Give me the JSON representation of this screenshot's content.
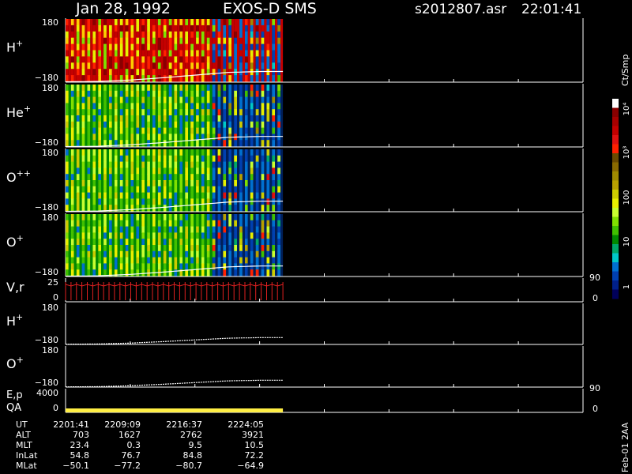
{
  "header": {
    "date": "Jan 28, 1992",
    "instrument": "EXOS-D SMS",
    "file": "s2012807.asr",
    "time": "22:01:41"
  },
  "colors": {
    "trace": "#ffffff",
    "velocity": "#e02020",
    "qa_bar": "#ffee44",
    "frame": "#ffffff"
  },
  "colorbar": {
    "unit": "Ct/Smp",
    "tick_labels": [
      "10⁴",
      "10³",
      "100",
      "10",
      "1"
    ],
    "colors": [
      "#ffffff",
      "#8a0000",
      "#a80000",
      "#c40000",
      "#e01010",
      "#ff2000",
      "#6a4a00",
      "#8a6a00",
      "#a08a00",
      "#b8a000",
      "#cccc00",
      "#e8f000",
      "#c8ff30",
      "#80e000",
      "#40c000",
      "#008a00",
      "#00a868",
      "#00c8c8",
      "#0070d0",
      "#0040b0",
      "#00208a",
      "#00005a"
    ]
  },
  "footer_note": "Feb-01 2AA",
  "chart_data": {
    "type": "heatmap",
    "panels": [
      {
        "name": "H+",
        "label_base": "H",
        "label_sup": "+",
        "ymax_label": "180",
        "ymin_label": "−180",
        "kind": "spectrogram",
        "style": "h"
      },
      {
        "name": "He+",
        "label_base": "He",
        "label_sup": "+",
        "ymax_label": "180",
        "ymin_label": "−180",
        "kind": "spectrogram",
        "style": "he"
      },
      {
        "name": "O++",
        "label_base": "O",
        "label_sup": "++",
        "ymax_label": "180",
        "ymin_label": "−180",
        "kind": "spectrogram",
        "style": "opp"
      },
      {
        "name": "O+",
        "label_base": "O",
        "label_sup": "+",
        "ymax_label": "180",
        "ymin_label": "−180",
        "kind": "spectrogram",
        "style": "op"
      },
      {
        "name": "V,r",
        "label_base": "V,r",
        "label_sup": "",
        "ymax_label": "25",
        "ymin_label": "0",
        "right_top": "90",
        "right_bottom": "0",
        "kind": "velocity"
      },
      {
        "name": "H+",
        "label_base": "H",
        "label_sup": "+",
        "ymax_label": "180",
        "ymin_label": "−180",
        "kind": "line"
      },
      {
        "name": "O+",
        "label_base": "O",
        "label_sup": "+",
        "ymax_label": "180",
        "ymin_label": "−180",
        "kind": "line"
      },
      {
        "name": "E,p / QA",
        "label_base": "E,p",
        "label2": "QA",
        "label_sup": "",
        "ymax_label": "4000",
        "ymin_label": "0",
        "right_top": "90",
        "right_bottom": "0",
        "kind": "qa"
      }
    ],
    "data_time_fraction": 0.42,
    "spin_stripe_count": 40,
    "pitch_angle_trace": [
      [
        0.0,
        -178
      ],
      [
        0.15,
        -176
      ],
      [
        0.3,
        -168
      ],
      [
        0.45,
        -155
      ],
      [
        0.6,
        -140
      ],
      [
        0.75,
        -125
      ],
      [
        0.9,
        -120
      ],
      [
        1.0,
        -120
      ]
    ],
    "time_axis": {
      "UT": [
        "2201:41",
        "2209:09",
        "2216:37",
        "2224:05"
      ],
      "ALT": [
        "703",
        "1627",
        "2762",
        "3921"
      ],
      "MLT": [
        "23.4",
        "0.3",
        "9.5",
        "10.5"
      ],
      "InLat": [
        "54.8",
        "76.7",
        "84.8",
        "72.2"
      ],
      "MLat": [
        "−50.1",
        "−77.2",
        "−80.7",
        "−64.9"
      ]
    },
    "row_labels": [
      "UT",
      "ALT",
      "MLT",
      "InLat",
      "MLat"
    ]
  }
}
